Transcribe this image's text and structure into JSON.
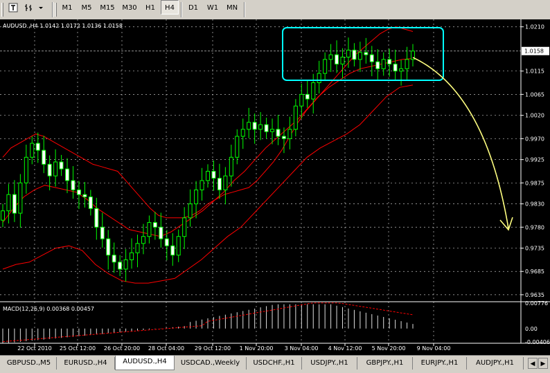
{
  "toolbar": {
    "timeframes": [
      {
        "label": "M1",
        "active": false
      },
      {
        "label": "M5",
        "active": false
      },
      {
        "label": "M15",
        "active": false
      },
      {
        "label": "M30",
        "active": false
      },
      {
        "label": "H1",
        "active": false
      },
      {
        "label": "H4",
        "active": true
      },
      {
        "label": "D1",
        "active": false
      },
      {
        "label": "W1",
        "active": false
      },
      {
        "label": "MN",
        "active": false
      }
    ]
  },
  "chart": {
    "header": "AUDUSD.,H4  1.0142 1.0172 1.0136 1.0158",
    "current_price": "1.0158",
    "price_labels": [
      "1.0210",
      "1.0115",
      "1.0065",
      "1.0020",
      "0.9970",
      "0.9925",
      "0.9875",
      "0.9830",
      "0.9780",
      "0.9735",
      "0.9685",
      "0.9635"
    ],
    "date_labels": [
      "22 Oct 2010",
      "25 Oct 12:00",
      "26 Oct 20:00",
      "28 Oct 04:00",
      "29 Oct 12:00",
      "1 Nov 20:00",
      "3 Nov 04:00",
      "4 Nov 12:00",
      "5 Nov 20:00",
      "9 Nov 04:00"
    ],
    "macd_header": "MACD(12,26,9) 0.00368 0.00457",
    "macd_labels": [
      "0.00776",
      "0.00",
      "-0.00406"
    ],
    "colors": {
      "background": "#000000",
      "grid": "#c0c0c0",
      "candle": "#00ff00",
      "bands": "#ff0000",
      "box": "#00ffff",
      "arrow": "#ffff80"
    }
  },
  "chart_data": {
    "type": "candlestick",
    "symbol": "AUDUSD.",
    "timeframe": "H4",
    "last": {
      "open": 1.0142,
      "high": 1.0172,
      "low": 1.0136,
      "close": 1.0158
    },
    "ylim": [
      0.962,
      1.022
    ],
    "close_series": [
      0.9815,
      0.985,
      0.981,
      0.9875,
      0.993,
      0.996,
      0.9945,
      0.9915,
      0.989,
      0.992,
      0.9905,
      0.988,
      0.986,
      0.985,
      0.9845,
      0.982,
      0.978,
      0.9755,
      0.972,
      0.9705,
      0.969,
      0.971,
      0.9725,
      0.9745,
      0.976,
      0.979,
      0.978,
      0.9755,
      0.974,
      0.972,
      0.976,
      0.98,
      0.983,
      0.986,
      0.988,
      0.99,
      0.9885,
      0.986,
      0.989,
      0.993,
      0.9975,
      0.999,
      1.0005,
      0.999,
      1.0,
      0.9985,
      0.999,
      0.9975,
      0.997,
      0.999,
      1.004,
      1.0065,
      1.0055,
      1.009,
      1.011,
      1.014,
      1.015,
      1.013,
      1.0145,
      1.016,
      1.014,
      1.0155,
      1.015,
      1.0135,
      1.012,
      1.014,
      1.013,
      1.0115,
      1.012,
      1.014,
      1.0158
    ],
    "bands_upper": [
      0.993,
      0.995,
      0.996,
      0.997,
      0.998,
      0.9975,
      0.9965,
      0.9955,
      0.9945,
      0.9935,
      0.9925,
      0.9915,
      0.991,
      0.9905,
      0.99,
      0.988,
      0.986,
      0.984,
      0.982,
      0.9805,
      0.98,
      0.98,
      0.98,
      0.9805,
      0.9815,
      0.983,
      0.984,
      0.985,
      0.9855,
      0.986,
      0.9865,
      0.988,
      0.99,
      0.992,
      0.9945,
      0.9975,
      1.0005,
      1.003,
      1.005,
      1.007,
      1.009,
      1.011,
      1.013,
      1.015,
      1.0165,
      1.018,
      1.0195,
      1.0205,
      1.021,
      1.0205,
      1.02
    ],
    "bands_middle": [
      0.979,
      0.982,
      0.9845,
      0.986,
      0.987,
      0.9865,
      0.986,
      0.9855,
      0.984,
      0.982,
      0.9805,
      0.979,
      0.9775,
      0.977,
      0.9765,
      0.976,
      0.977,
      0.9785,
      0.98,
      0.9815,
      0.9835,
      0.9855,
      0.988,
      0.99,
      0.9925,
      0.995,
      0.997,
      0.999,
      1.001,
      1.0035,
      1.006,
      1.008,
      1.0095,
      1.011,
      1.012,
      1.0125,
      1.013,
      1.0135,
      1.014,
      1.0142
    ],
    "bands_lower": [
      0.969,
      0.97,
      0.9705,
      0.972,
      0.9735,
      0.974,
      0.973,
      0.97,
      0.968,
      0.9665,
      0.966,
      0.966,
      0.9665,
      0.967,
      0.969,
      0.971,
      0.9735,
      0.976,
      0.978,
      0.981,
      0.984,
      0.987,
      0.99,
      0.993,
      0.995,
      0.9965,
      0.998,
      1.0,
      1.003,
      1.006,
      1.008,
      1.0085
    ],
    "macd": {
      "value": 0.00368,
      "signal": 0.00457,
      "ylim": [
        -0.00406,
        0.00776
      ]
    }
  },
  "tabs": [
    {
      "label": "GBPUSD.,M5",
      "active": false
    },
    {
      "label": "EURUSD.,H4",
      "active": false
    },
    {
      "label": "AUDUSD.,H4",
      "active": true
    },
    {
      "label": "USDCAD.,Weekly",
      "active": false
    },
    {
      "label": "USDCHF.,H1",
      "active": false
    },
    {
      "label": "USDJPY.,H1",
      "active": false
    },
    {
      "label": "GBPJPY.,H1",
      "active": false
    },
    {
      "label": "EURJPY.,H1",
      "active": false
    },
    {
      "label": "AUDJPY.,H1",
      "active": false
    }
  ]
}
